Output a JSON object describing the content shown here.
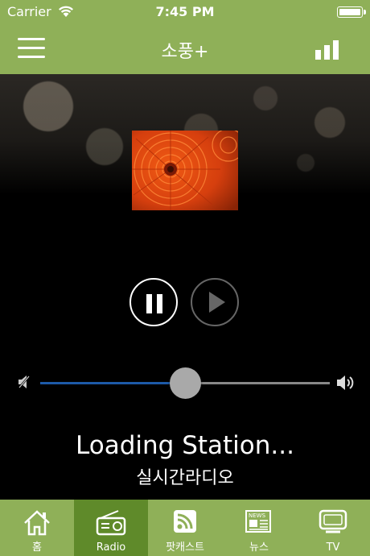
{
  "status_bar": {
    "carrier": "Carrier",
    "time": "7:45 PM"
  },
  "nav": {
    "title": "소풍+"
  },
  "player": {
    "station_title": "Loading Station...",
    "subtitle": "실시간라디오",
    "volume_level": 0.5
  },
  "tabs": [
    {
      "label": "홈",
      "icon": "home-icon"
    },
    {
      "label": "Radio",
      "icon": "radio-icon",
      "active": true
    },
    {
      "label": "팟캐스트",
      "icon": "podcast-icon"
    },
    {
      "label": "뉴스",
      "icon": "news-icon"
    },
    {
      "label": "TV",
      "icon": "tv-icon"
    }
  ],
  "colors": {
    "bar_green": "#8fb058",
    "active_tab": "#5f8a2a",
    "slider_fill": "#1d5aa8"
  }
}
